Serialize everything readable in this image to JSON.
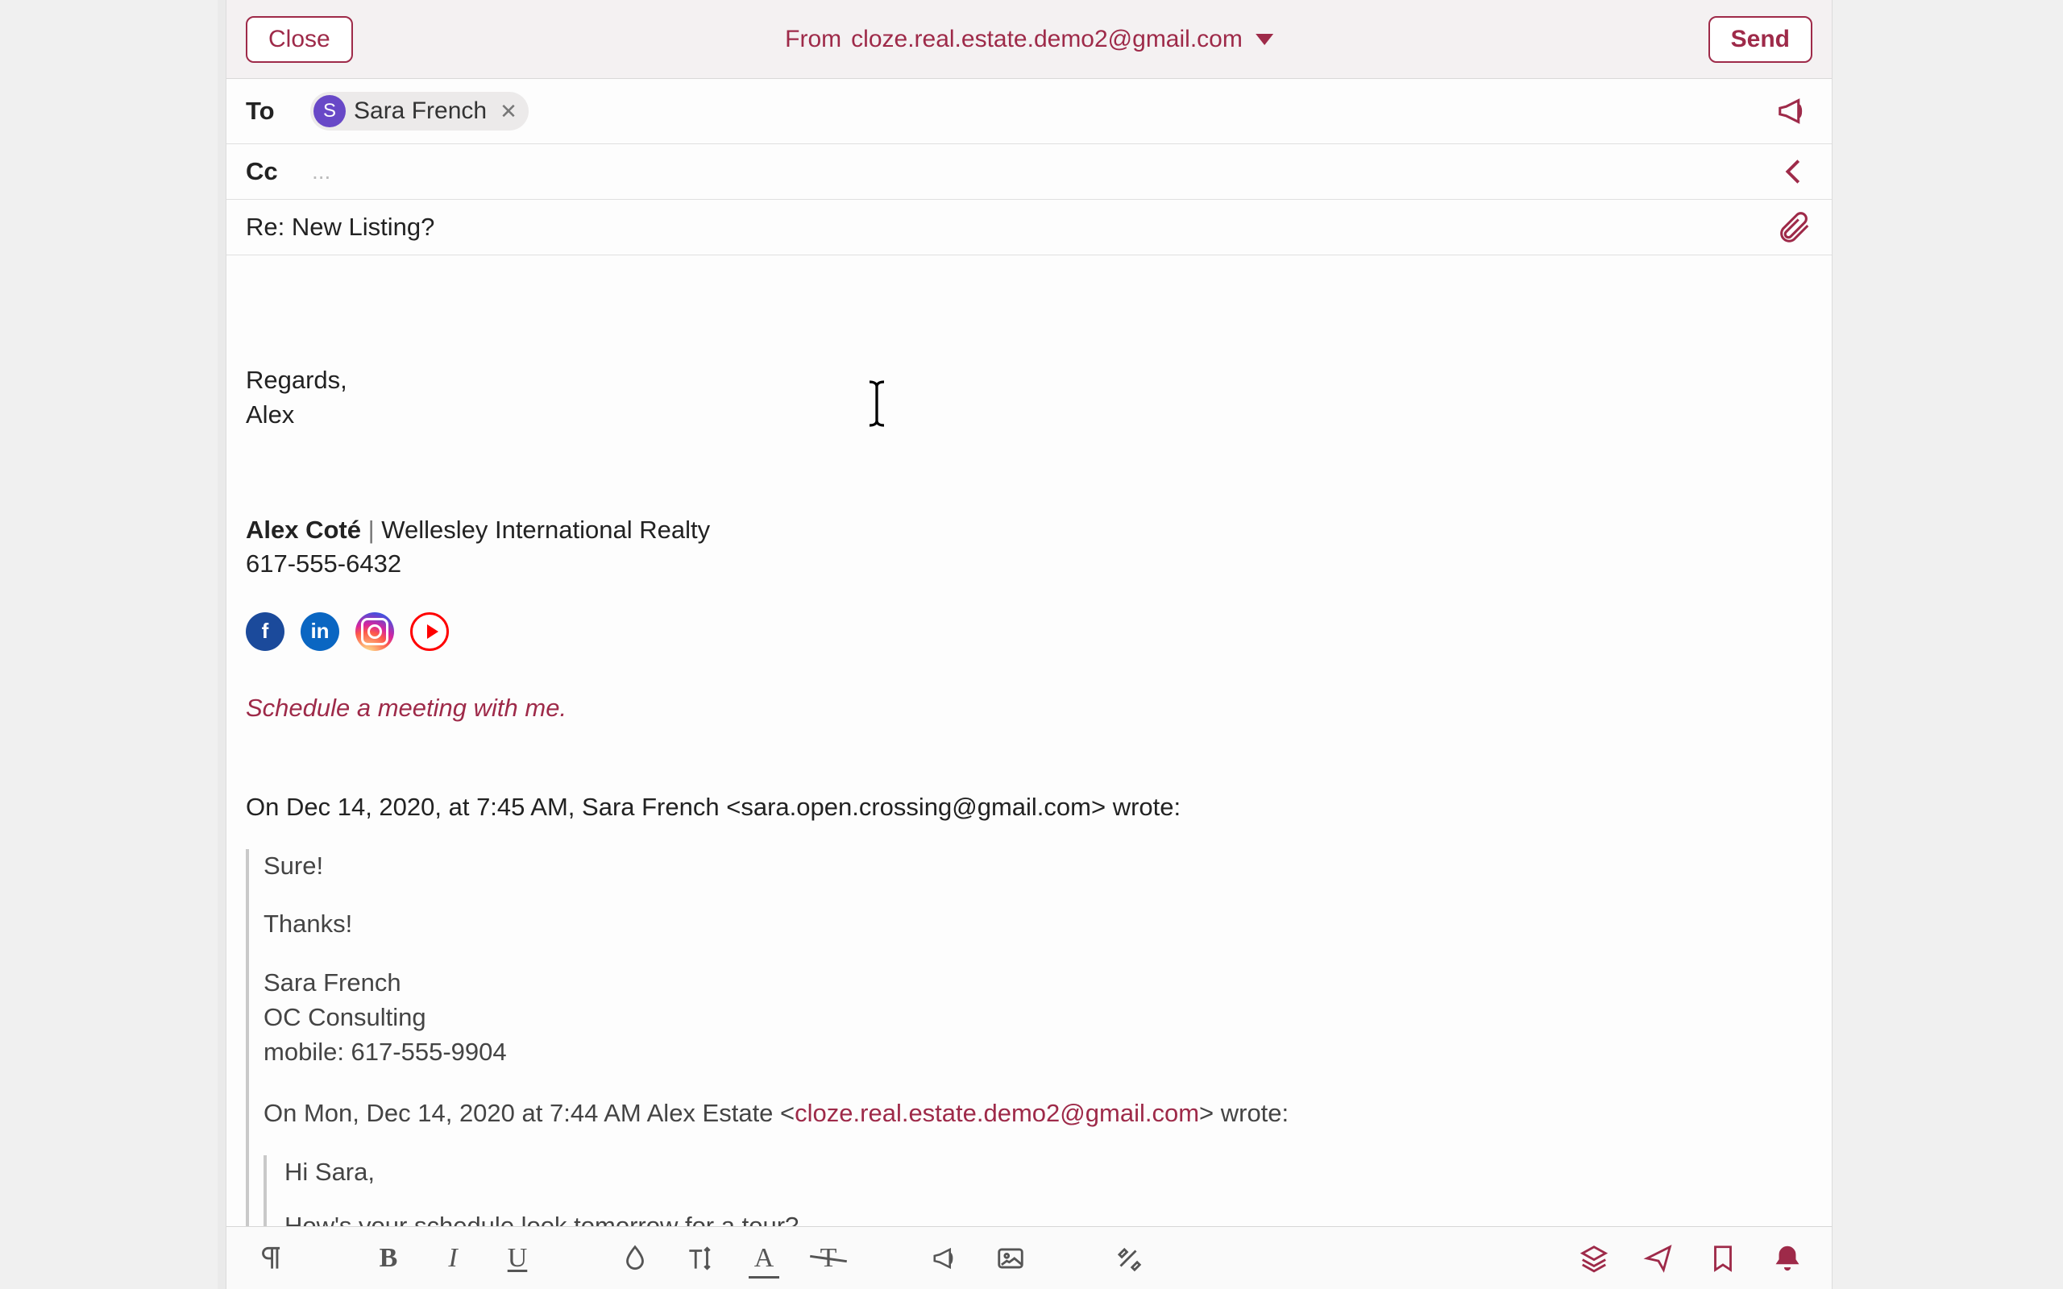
{
  "header": {
    "close_label": "Close",
    "send_label": "Send",
    "from_label": "From",
    "from_address": "cloze.real.estate.demo2@gmail.com"
  },
  "to": {
    "label": "To",
    "recipient": {
      "initial": "S",
      "name": "Sara French"
    }
  },
  "cc": {
    "label": "Cc",
    "placeholder": "..."
  },
  "subject": "Re: New Listing?",
  "signature": {
    "closing": "Regards,",
    "first_name": "Alex",
    "full_name": "Alex Coté",
    "separator": "  |  ",
    "company": "Wellesley International Realty",
    "phone": "617-555-6432",
    "schedule_link": "Schedule a meeting with me."
  },
  "quoted": {
    "attribution": "On Dec 14, 2020, at 7:45 AM, Sara French <sara.open.crossing@gmail.com> wrote:",
    "lines": {
      "l1": "Sure!",
      "l2": "Thanks!",
      "l3": "Sara French",
      "l4": "OC Consulting",
      "l5": "mobile: 617-555-9904"
    },
    "reply_attrib_prefix": "On Mon, Dec 14, 2020 at 7:44 AM Alex Estate <",
    "reply_attrib_email": "cloze.real.estate.demo2@gmail.com",
    "reply_attrib_suffix": "> wrote:",
    "inner": {
      "l1": "Hi Sara,",
      "l2": "How's your schedule look tomorrow for a tour?"
    }
  },
  "icons": {
    "facebook": "f",
    "linkedin": "in"
  }
}
